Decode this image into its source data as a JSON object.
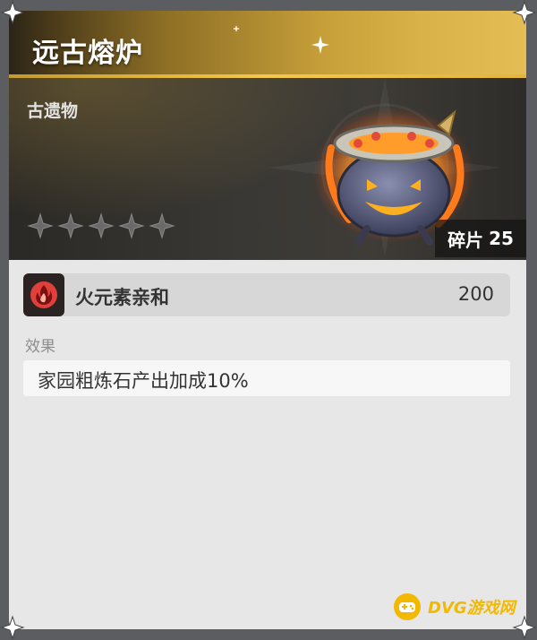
{
  "header": {
    "title": "远古熔炉"
  },
  "relic": {
    "category": "古遗物",
    "stars_total": 5,
    "stars_filled": 0,
    "fragments_label": "碎片",
    "fragments_count": "25",
    "image_icon": "pumpkin-cauldron-icon"
  },
  "stat": {
    "icon": "fire-element-icon",
    "name": "火元素亲和",
    "value": "200"
  },
  "effect": {
    "label": "效果",
    "text": "家园粗炼石产出加成10%"
  },
  "watermark": {
    "text": "DVG游戏网"
  },
  "colors": {
    "header_gold": "#d9b24a",
    "banner_dark": "#3a3834",
    "fire_red": "#e0403a",
    "watermark_yellow": "#f3b800"
  }
}
